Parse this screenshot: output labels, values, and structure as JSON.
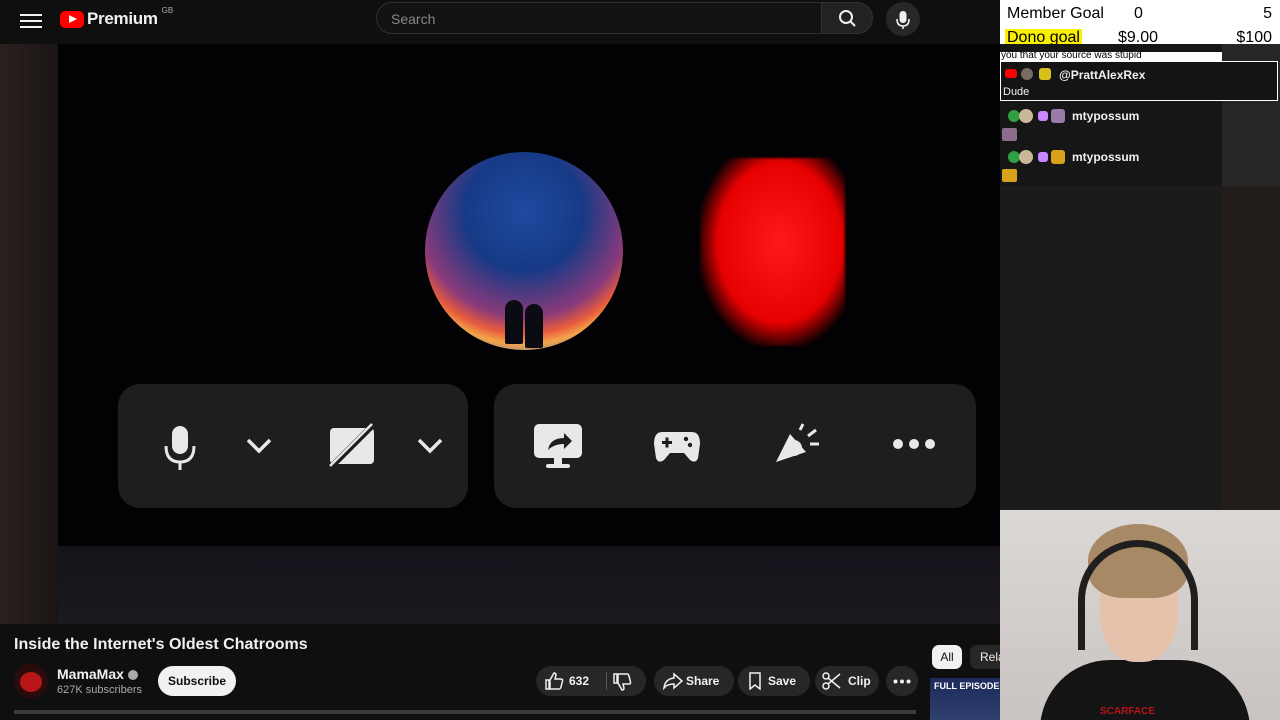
{
  "header": {
    "logo_text": "Premium",
    "logo_region": "GB",
    "search_placeholder": "Search"
  },
  "video": {
    "title": "Inside the Internet's Oldest Chatrooms"
  },
  "channel": {
    "name": "MamaMax",
    "subscribers": "627K subscribers",
    "subscribe_label": "Subscribe"
  },
  "actions": {
    "likes": "632",
    "share_label": "Share",
    "save_label": "Save",
    "clip_label": "Clip"
  },
  "filters": {
    "all_label": "All",
    "related_label": "Rela"
  },
  "recommended": {
    "thumb_text": "FULL EPISODE!"
  },
  "goals": {
    "member": {
      "label": "Member Goal",
      "current": "0",
      "target": "5"
    },
    "dono": {
      "label": "Dono goal",
      "current": "$9.00",
      "target": "$100"
    },
    "highlight_color": "#f8f000"
  },
  "chat": {
    "cut_off_text": "you that your source was stupid",
    "messages": [
      {
        "user": "@PrattAlexRex",
        "text": "Dude"
      },
      {
        "user": "mtypossum",
        "text": ""
      },
      {
        "user": "mtypossum",
        "text": ""
      }
    ]
  },
  "webcam": {
    "shirt_text": "SCARFACE"
  },
  "colors": {
    "brand_red": "#ff0000",
    "endcall_red": "#ff1d1d",
    "background": "#0f0f0f"
  }
}
